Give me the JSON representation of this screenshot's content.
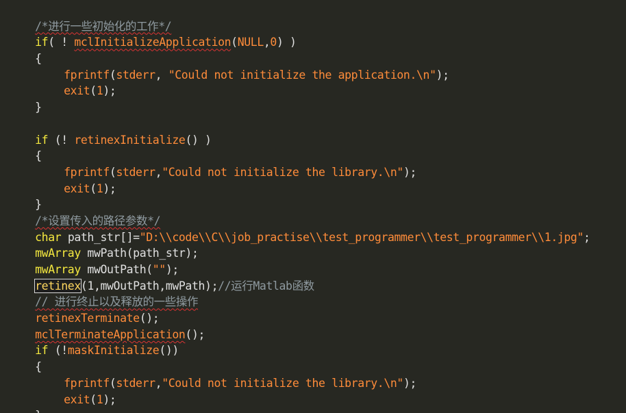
{
  "code": {
    "l1": "/*进行一些初始化的工作*/",
    "l2a": "if",
    "l2b": "( ! ",
    "l2c": "mclInitializeApplication",
    "l2d": "(",
    "l2e": "NULL",
    "l2f": ",",
    "l2g": "0",
    "l2h": ") )",
    "l3": "{",
    "l4a": "fprintf",
    "l4b": "(",
    "l4c": "stderr",
    "l4d": ", ",
    "l4e": "\"Could not initialize the application.\\n\"",
    "l4f": ");",
    "l5a": "exit",
    "l5b": "(",
    "l5c": "1",
    "l5d": ");",
    "l6": "}",
    "l7": "",
    "l8a": "if",
    "l8b": " (! ",
    "l8c": "retinexInitialize",
    "l8d": "() )",
    "l9": "{",
    "l10a": "fprintf",
    "l10b": "(",
    "l10c": "stderr",
    "l10d": ",",
    "l10e": "\"Could not initialize the library.\\n\"",
    "l10f": ");",
    "l11a": "exit",
    "l11b": "(",
    "l11c": "1",
    "l11d": ");",
    "l12": "}",
    "l13": "/*设置传入的路径参数*/",
    "l14a": "char",
    "l14b": " path_str[]=",
    "l14c": "\"D:\\\\code\\\\C\\\\job_practise\\\\test_programmer\\\\test_programmer\\\\1.jpg\"",
    "l14d": ";",
    "l15a": "mwArray",
    "l15b": " mwPath(path_str);",
    "l16a": "mwArray",
    "l16b": " mwOutPath(",
    "l16c": "\"\"",
    "l16d": ");",
    "l17a": "retinex",
    "l17b": "(1,mwOutPath,mwPath);",
    "l17c": "//运行Matlab函数",
    "l18": "// 进行终止以及释放的一些操作",
    "l19a": "retinexTerminate",
    "l19b": "();",
    "l20a": "mclTerminateApplication",
    "l20b": "();",
    "l21a": "if",
    "l21b": " (!",
    "l21c": "maskInitialize",
    "l21d": "())",
    "l22": "{",
    "l23a": "fprintf",
    "l23b": "(",
    "l23c": "stderr",
    "l23d": ",",
    "l23e": "\"Could not initialize the library.\\n\"",
    "l23f": ");",
    "l24a": "exit",
    "l24b": "(",
    "l24c": "1",
    "l24d": ");",
    "l25": "}"
  },
  "colors": {
    "background": "#272822",
    "keyword": "#f5e93f",
    "function": "#ff8c3a",
    "comment": "#8f9aa0"
  }
}
